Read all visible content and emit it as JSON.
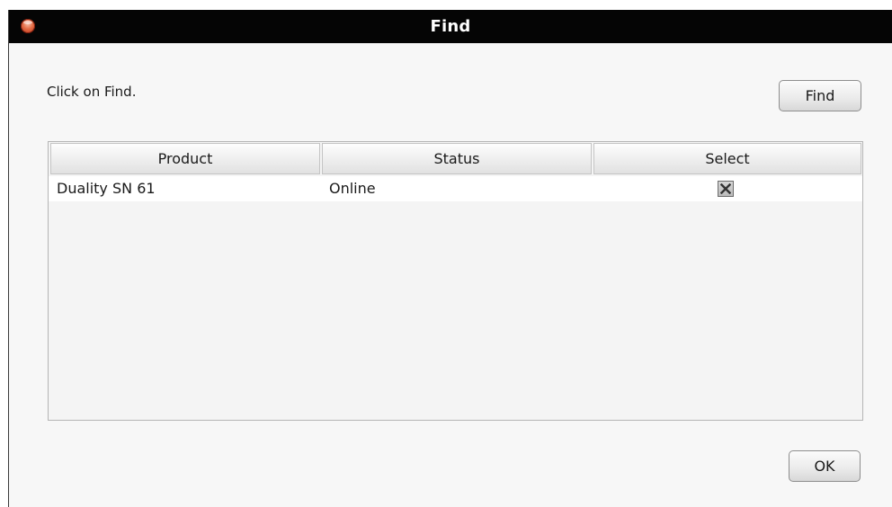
{
  "window": {
    "title": "Find"
  },
  "instruction": "Click on Find.",
  "buttons": {
    "find_label": "Find",
    "ok_label": "OK"
  },
  "table": {
    "columns": [
      "Product",
      "Status",
      "Select"
    ],
    "rows": [
      {
        "product": "Duality SN 61",
        "status": "Online",
        "selected": true
      }
    ]
  },
  "icons": {
    "close": "close-circle-icon",
    "checkbox_mark": "x-mark-icon"
  },
  "colors": {
    "titlebar": "#050505",
    "title_text": "#ffffff",
    "close_button": "#e36a43",
    "dialog_background": "#f7f7f7"
  }
}
